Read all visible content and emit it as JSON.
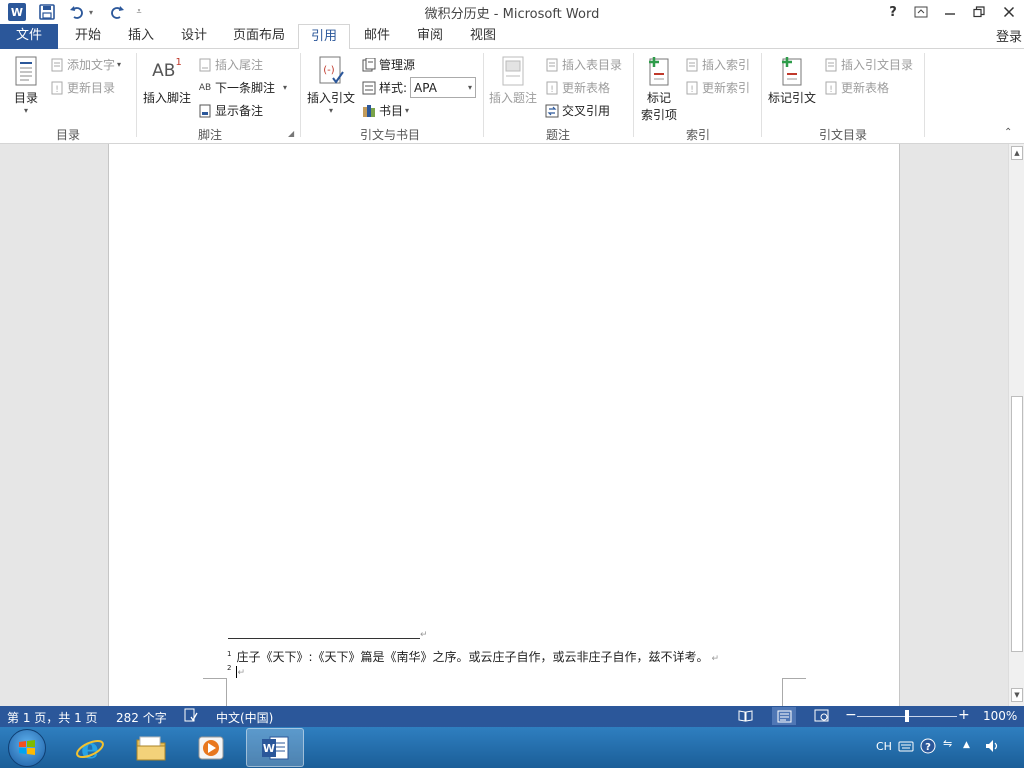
{
  "window": {
    "title": "微积分历史 - Microsoft Word",
    "help": "?",
    "login": "登录"
  },
  "tabs": [
    {
      "label": "文件"
    },
    {
      "label": "开始"
    },
    {
      "label": "插入"
    },
    {
      "label": "设计"
    },
    {
      "label": "页面布局"
    },
    {
      "label": "引用"
    },
    {
      "label": "邮件"
    },
    {
      "label": "审阅"
    },
    {
      "label": "视图"
    }
  ],
  "ribbon": {
    "toc": {
      "toc_label": "目录",
      "add_text": "添加文字",
      "update_toc": "更新目录",
      "group": "目录"
    },
    "footnotes": {
      "insert_footnote": "插入脚注",
      "insert_endnote": "插入尾注",
      "next_footnote": "下一条脚注",
      "show_notes": "显示备注",
      "group": "脚注",
      "ab_glyph": "AB",
      "sup": "1"
    },
    "citations": {
      "insert_citation": "插入引文",
      "manage_sources": "管理源",
      "style_label": "样式:",
      "style_value": "APA",
      "bibliography": "书目",
      "group": "引文与书目"
    },
    "captions": {
      "insert_caption": "插入题注",
      "insert_table_figures": "插入表目录",
      "update_table": "更新表格",
      "cross_reference": "交叉引用",
      "group": "题注"
    },
    "index": {
      "mark_entry_line1": "标记",
      "mark_entry_line2": "索引项",
      "insert_index": "插入索引",
      "update_index": "更新索引",
      "group": "索引"
    },
    "authorities": {
      "mark_citation": "标记引文",
      "insert_toa": "插入引文目录",
      "update_table": "更新表格",
      "group": "引文目录"
    }
  },
  "document": {
    "footnotes": [
      {
        "num": "1",
        "text": "庄子《天下》:《天下》篇是《南华》之序。或云庄子自作，或云非庄子自作，兹不详考。"
      },
      {
        "num": "2",
        "text": ""
      }
    ]
  },
  "statusbar": {
    "page": "第 1 页，共 1 页",
    "words": "282 个字",
    "language": "中文(中国)",
    "zoom": "100%",
    "zoom_level": 0.5
  },
  "taskbar": {
    "lang": "CH"
  },
  "colors": {
    "accent": "#2b579a"
  }
}
